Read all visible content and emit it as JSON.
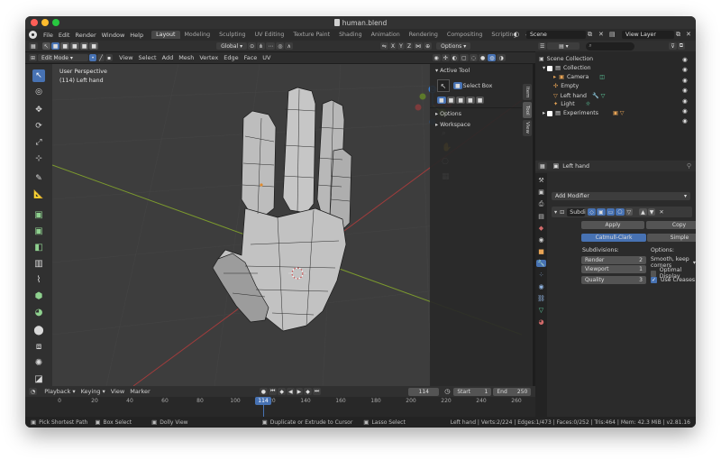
{
  "window": {
    "title": "human.blend"
  },
  "menu": [
    "File",
    "Edit",
    "Render",
    "Window",
    "Help"
  ],
  "workspaces": [
    {
      "label": "Layout",
      "active": true
    },
    {
      "label": "Modeling"
    },
    {
      "label": "Sculpting"
    },
    {
      "label": "UV Editing"
    },
    {
      "label": "Texture Paint"
    },
    {
      "label": "Shading"
    },
    {
      "label": "Animation"
    },
    {
      "label": "Rendering"
    },
    {
      "label": "Compositing"
    },
    {
      "label": "Scripting"
    }
  ],
  "scene": "Scene",
  "view_layer": "View Layer",
  "tool_header": {
    "orientation": "Global",
    "axes": [
      "X",
      "Y",
      "Z"
    ],
    "options": "Options"
  },
  "viewport_header": {
    "mode": "Edit Mode",
    "menus": [
      "View",
      "Select",
      "Add",
      "Mesh",
      "Vertex",
      "Edge",
      "Face",
      "UV"
    ]
  },
  "viewport": {
    "perspective": "User Perspective",
    "object_label": "(114) Left hand"
  },
  "npanel": {
    "active_tool_title": "Active Tool",
    "select_box": "Select Box",
    "options": "Options",
    "workspace": "Workspace",
    "tabs": [
      "Item",
      "Tool",
      "View"
    ]
  },
  "outliner": {
    "search_placeholder": "",
    "items": [
      {
        "label": "Scene Collection",
        "depth": 0
      },
      {
        "label": "Collection",
        "depth": 1
      },
      {
        "label": "Camera",
        "depth": 2
      },
      {
        "label": "Empty",
        "depth": 2
      },
      {
        "label": "Left hand",
        "depth": 2
      },
      {
        "label": "Light",
        "depth": 2
      },
      {
        "label": "Experiments",
        "depth": 1
      }
    ]
  },
  "properties": {
    "object": "Left hand",
    "add_modifier": "Add Modifier",
    "modifier_name": "Subdi",
    "apply": "Apply",
    "copy": "Copy",
    "algorithm": [
      "Catmull-Clark",
      "Simple"
    ],
    "subdivisions_label": "Subdivisions:",
    "options_label": "Options:",
    "render_label": "Render",
    "render_value": "2",
    "viewport_label": "Viewport",
    "viewport_value": "1",
    "quality_label": "Quality",
    "quality_value": "3",
    "uv_smooth": "Smooth, keep corners",
    "optimal_display": "Optimal Display",
    "optimal_display_checked": false,
    "use_creases": "Use Creases",
    "use_creases_checked": true
  },
  "timeline": {
    "menus": [
      "Playback",
      "Keying",
      "View",
      "Marker"
    ],
    "current_frame": "114",
    "start_label": "Start",
    "start": "1",
    "end_label": "End",
    "end": "250",
    "ticks": [
      "0",
      "20",
      "40",
      "60",
      "80",
      "100",
      "120",
      "140",
      "160",
      "180",
      "200",
      "220",
      "240",
      "260"
    ],
    "playhead": "114"
  },
  "status": {
    "pick": "Pick Shortest Path",
    "box": "Box Select",
    "dolly": "Dolly View",
    "duplicate": "Duplicate or Extrude to Cursor",
    "lasso": "Lasso Select",
    "stats": "Left hand | Verts:2/224 | Edges:1/473 | Faces:0/252 | Tris:464 | Mem: 42.3 MiB | v2.81.16"
  },
  "colors": {
    "accent": "#4772b3",
    "x_axis": "#c8484b",
    "y_axis": "#8bb83a",
    "z_axis": "#3b7fd4"
  }
}
